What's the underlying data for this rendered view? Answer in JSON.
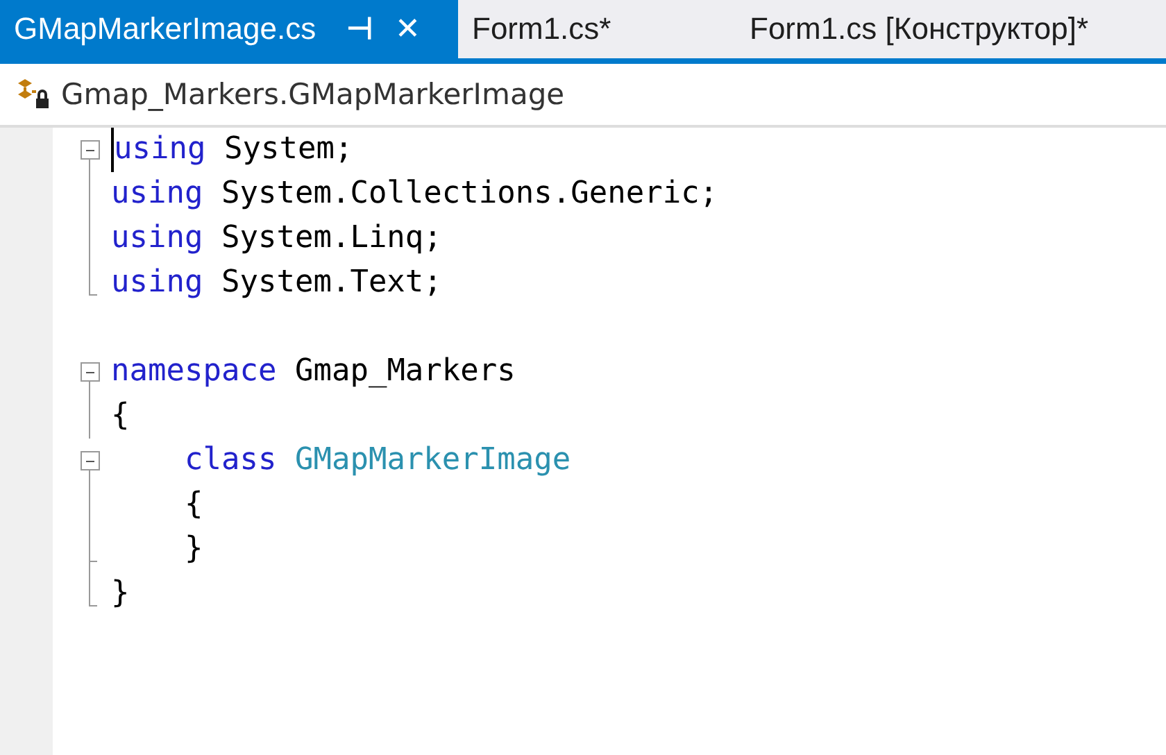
{
  "tabs": [
    {
      "label": "GMapMarkerImage.cs",
      "selected": true,
      "pin": "⊣",
      "close": "✕"
    },
    {
      "label": "Form1.cs*",
      "selected": false
    },
    {
      "label": "Form1.cs [Конструктор]*",
      "selected": false
    }
  ],
  "navigation_bar": {
    "label": "Gmap_Markers.GMapMarkerImage"
  },
  "editor": {
    "lines": [
      {
        "kind": "start",
        "cursor": true,
        "tokens": [
          {
            "text": "using",
            "kind": "keyword"
          },
          {
            "text": " System;",
            "kind": "plain"
          }
        ]
      },
      {
        "kind": "body",
        "cursor": false,
        "tokens": [
          {
            "text": "using",
            "kind": "keyword"
          },
          {
            "text": " System.Collections.Generic;",
            "kind": "plain"
          }
        ]
      },
      {
        "kind": "body",
        "cursor": false,
        "tokens": [
          {
            "text": "using",
            "kind": "keyword"
          },
          {
            "text": " System.Linq;",
            "kind": "plain"
          }
        ]
      },
      {
        "kind": "end",
        "cursor": false,
        "tokens": [
          {
            "text": "using",
            "kind": "keyword"
          },
          {
            "text": " System.Text;",
            "kind": "plain"
          }
        ]
      },
      {
        "kind": "blank",
        "cursor": false
      },
      {
        "kind": "start",
        "cursor": false,
        "tokens": [
          {
            "text": "namespace",
            "kind": "keyword"
          },
          {
            "text": " Gmap_Markers",
            "kind": "plain"
          }
        ]
      },
      {
        "kind": "body",
        "cursor": false,
        "tokens": [
          {
            "text": "{",
            "kind": "plain"
          }
        ]
      },
      {
        "kind": "start",
        "cursor": false,
        "tokens": [
          {
            "text": "    class",
            "kind": "keyword"
          },
          {
            "text": " GMapMarkerImage",
            "kind": "type"
          }
        ]
      },
      {
        "kind": "body",
        "cursor": false,
        "tokens": [
          {
            "text": "    {",
            "kind": "plain"
          }
        ]
      },
      {
        "kind": "inner-end",
        "cursor": false,
        "tokens": [
          {
            "text": "    }",
            "kind": "plain"
          }
        ]
      },
      {
        "kind": "end",
        "cursor": false,
        "tokens": [
          {
            "text": "}",
            "kind": "plain"
          }
        ]
      }
    ]
  }
}
